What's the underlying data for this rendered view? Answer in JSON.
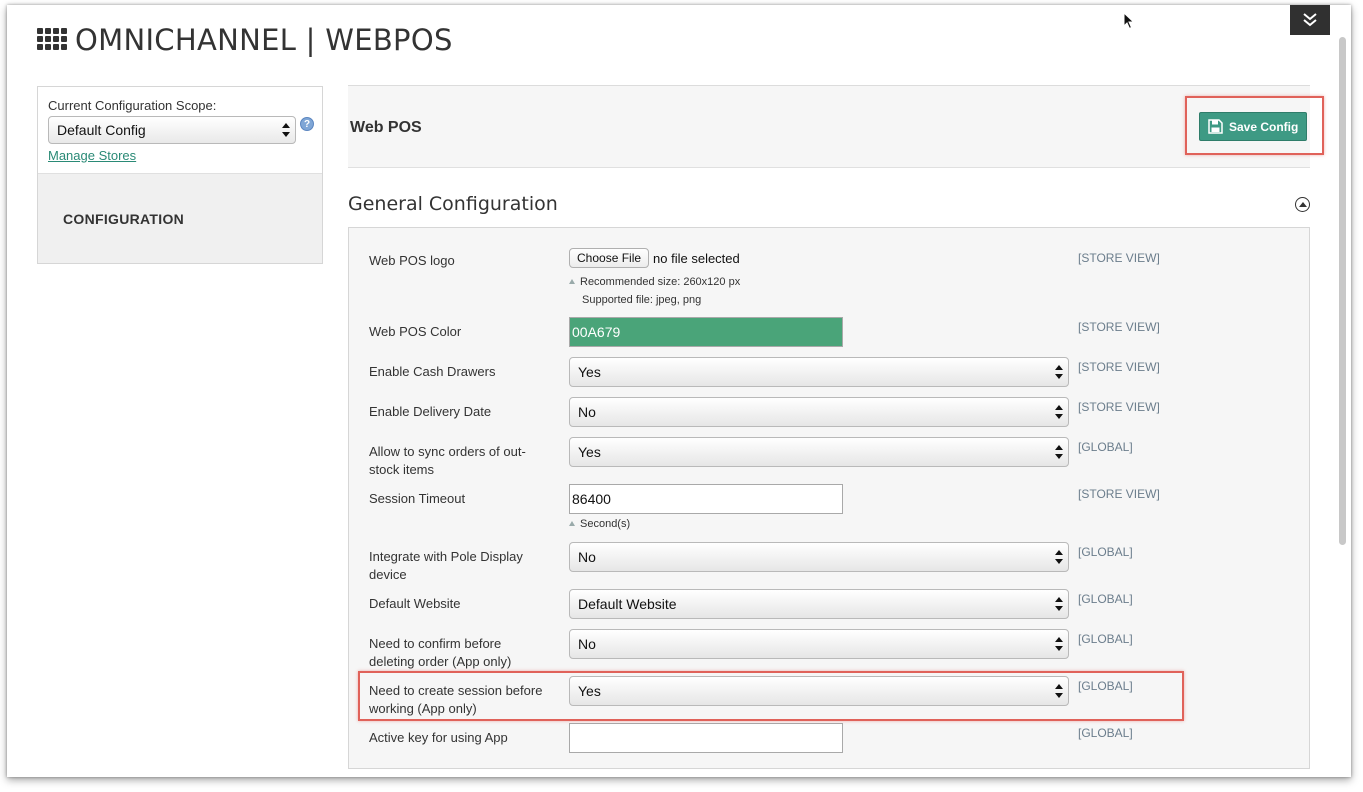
{
  "app": {
    "title": "OMNICHANNEL | WEBPOS"
  },
  "sidebar": {
    "scope_label": "Current Configuration Scope:",
    "scope_value": "Default Config",
    "help_glyph": "?",
    "manage_stores": "Manage Stores",
    "nav_item": "CONFIGURATION"
  },
  "page": {
    "title": "Web POS",
    "save_label": "Save Config"
  },
  "section": {
    "title": "General Configuration"
  },
  "fields": {
    "logo": {
      "label": "Web POS logo",
      "button": "Choose File",
      "status": "no file selected",
      "note_1": "Recommended size: 260x120 px",
      "note_2": "Supported file: jpeg, png",
      "scope": "[STORE VIEW]"
    },
    "color": {
      "label": "Web POS Color",
      "value": "00A679",
      "scope": "[STORE VIEW]"
    },
    "cash_drawers": {
      "label": "Enable Cash Drawers",
      "value": "Yes",
      "scope": "[STORE VIEW]"
    },
    "delivery_date": {
      "label": "Enable Delivery Date",
      "value": "No",
      "scope": "[STORE VIEW]"
    },
    "sync_orders": {
      "label": "Allow to sync orders of out-stock items",
      "value": "Yes",
      "scope": "[GLOBAL]"
    },
    "session_timeout": {
      "label": "Session Timeout",
      "value": "86400",
      "note": "Second(s)",
      "scope": "[STORE VIEW]"
    },
    "pole_display": {
      "label": "Integrate with Pole Display device",
      "value": "No",
      "scope": "[GLOBAL]"
    },
    "default_website": {
      "label": "Default Website",
      "value": "Default Website",
      "scope": "[GLOBAL]"
    },
    "confirm_delete": {
      "label": "Need to confirm before deleting order (App only)",
      "value": "No",
      "scope": "[GLOBAL]"
    },
    "create_session": {
      "label": "Need to create session before working (App only)",
      "value": "Yes",
      "scope": "[GLOBAL]"
    },
    "active_key": {
      "label": "Active key for using App",
      "value": "",
      "scope": "[GLOBAL]"
    }
  },
  "colors": {
    "accent": "#3e9a84",
    "pos_color": "#4aa479",
    "highlight": "#e0625a"
  },
  "icons": {
    "menu": "grid-icon",
    "collapse": "double-chevron-down-icon",
    "save": "floppy-disk-icon",
    "toggle": "chevron-up-circle-icon"
  }
}
